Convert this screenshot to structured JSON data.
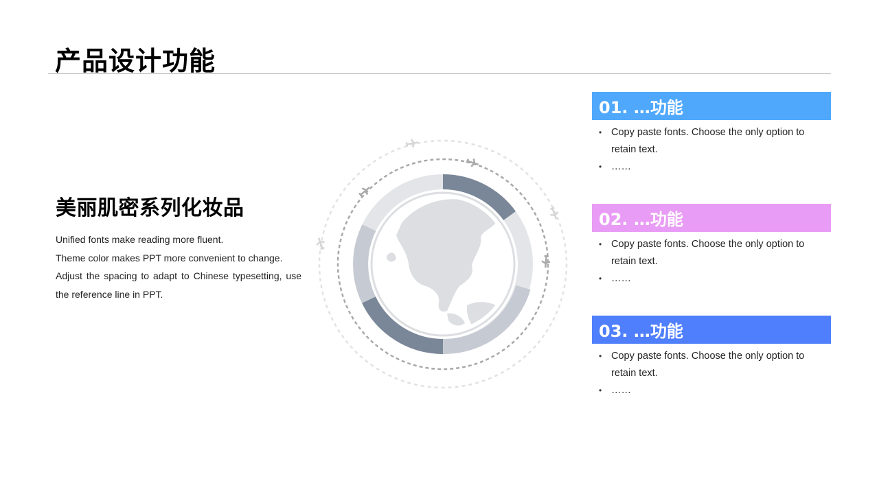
{
  "slide": {
    "title": "产品设计功能"
  },
  "left": {
    "subtitle": "美丽肌密系列化妆品",
    "lines": [
      "Unified fonts make reading more fluent.",
      "Theme color makes PPT more convenient to change.",
      "Adjust the spacing to adapt to Chinese typesetting, use the reference line in PPT."
    ]
  },
  "features": [
    {
      "label": "01. …功能",
      "color": "#4fa8fc",
      "bullets": [
        "Copy paste fonts. Choose the only option to retain text.",
        "……"
      ]
    },
    {
      "label": "02. …功能",
      "color": "#e99cf5",
      "bullets": [
        "Copy paste fonts. Choose the only option to retain text.",
        "……"
      ]
    },
    {
      "label": "03. …功能",
      "color": "#4f7ffc",
      "bullets": [
        "Copy paste fonts. Choose the only option to retain text.",
        "……"
      ]
    }
  ],
  "graphic": {
    "icons": [
      "globe-icon",
      "airplane-icon"
    ],
    "colors": {
      "dark_segment": "#7a8798",
      "mid_segment": "#c6cbd3",
      "light_segment": "#e3e5e9",
      "map": "#dcdee1"
    }
  }
}
